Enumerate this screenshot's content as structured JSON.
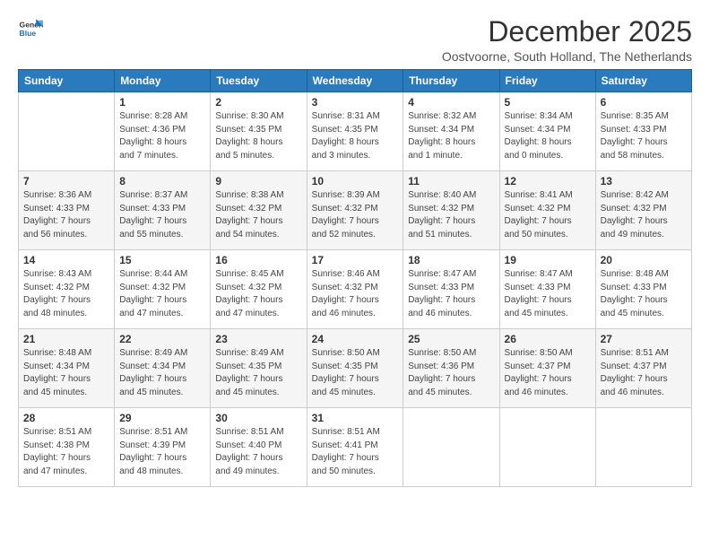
{
  "logo": {
    "text_general": "General",
    "text_blue": "Blue"
  },
  "header": {
    "title": "December 2025",
    "subtitle": "Oostvoorne, South Holland, The Netherlands"
  },
  "columns": [
    "Sunday",
    "Monday",
    "Tuesday",
    "Wednesday",
    "Thursday",
    "Friday",
    "Saturday"
  ],
  "weeks": [
    [
      {
        "day": "",
        "info": ""
      },
      {
        "day": "1",
        "info": "Sunrise: 8:28 AM\nSunset: 4:36 PM\nDaylight: 8 hours\nand 7 minutes."
      },
      {
        "day": "2",
        "info": "Sunrise: 8:30 AM\nSunset: 4:35 PM\nDaylight: 8 hours\nand 5 minutes."
      },
      {
        "day": "3",
        "info": "Sunrise: 8:31 AM\nSunset: 4:35 PM\nDaylight: 8 hours\nand 3 minutes."
      },
      {
        "day": "4",
        "info": "Sunrise: 8:32 AM\nSunset: 4:34 PM\nDaylight: 8 hours\nand 1 minute."
      },
      {
        "day": "5",
        "info": "Sunrise: 8:34 AM\nSunset: 4:34 PM\nDaylight: 8 hours\nand 0 minutes."
      },
      {
        "day": "6",
        "info": "Sunrise: 8:35 AM\nSunset: 4:33 PM\nDaylight: 7 hours\nand 58 minutes."
      }
    ],
    [
      {
        "day": "7",
        "info": "Sunrise: 8:36 AM\nSunset: 4:33 PM\nDaylight: 7 hours\nand 56 minutes."
      },
      {
        "day": "8",
        "info": "Sunrise: 8:37 AM\nSunset: 4:33 PM\nDaylight: 7 hours\nand 55 minutes."
      },
      {
        "day": "9",
        "info": "Sunrise: 8:38 AM\nSunset: 4:32 PM\nDaylight: 7 hours\nand 54 minutes."
      },
      {
        "day": "10",
        "info": "Sunrise: 8:39 AM\nSunset: 4:32 PM\nDaylight: 7 hours\nand 52 minutes."
      },
      {
        "day": "11",
        "info": "Sunrise: 8:40 AM\nSunset: 4:32 PM\nDaylight: 7 hours\nand 51 minutes."
      },
      {
        "day": "12",
        "info": "Sunrise: 8:41 AM\nSunset: 4:32 PM\nDaylight: 7 hours\nand 50 minutes."
      },
      {
        "day": "13",
        "info": "Sunrise: 8:42 AM\nSunset: 4:32 PM\nDaylight: 7 hours\nand 49 minutes."
      }
    ],
    [
      {
        "day": "14",
        "info": "Sunrise: 8:43 AM\nSunset: 4:32 PM\nDaylight: 7 hours\nand 48 minutes."
      },
      {
        "day": "15",
        "info": "Sunrise: 8:44 AM\nSunset: 4:32 PM\nDaylight: 7 hours\nand 47 minutes."
      },
      {
        "day": "16",
        "info": "Sunrise: 8:45 AM\nSunset: 4:32 PM\nDaylight: 7 hours\nand 47 minutes."
      },
      {
        "day": "17",
        "info": "Sunrise: 8:46 AM\nSunset: 4:32 PM\nDaylight: 7 hours\nand 46 minutes."
      },
      {
        "day": "18",
        "info": "Sunrise: 8:47 AM\nSunset: 4:33 PM\nDaylight: 7 hours\nand 46 minutes."
      },
      {
        "day": "19",
        "info": "Sunrise: 8:47 AM\nSunset: 4:33 PM\nDaylight: 7 hours\nand 45 minutes."
      },
      {
        "day": "20",
        "info": "Sunrise: 8:48 AM\nSunset: 4:33 PM\nDaylight: 7 hours\nand 45 minutes."
      }
    ],
    [
      {
        "day": "21",
        "info": "Sunrise: 8:48 AM\nSunset: 4:34 PM\nDaylight: 7 hours\nand 45 minutes."
      },
      {
        "day": "22",
        "info": "Sunrise: 8:49 AM\nSunset: 4:34 PM\nDaylight: 7 hours\nand 45 minutes."
      },
      {
        "day": "23",
        "info": "Sunrise: 8:49 AM\nSunset: 4:35 PM\nDaylight: 7 hours\nand 45 minutes."
      },
      {
        "day": "24",
        "info": "Sunrise: 8:50 AM\nSunset: 4:35 PM\nDaylight: 7 hours\nand 45 minutes."
      },
      {
        "day": "25",
        "info": "Sunrise: 8:50 AM\nSunset: 4:36 PM\nDaylight: 7 hours\nand 45 minutes."
      },
      {
        "day": "26",
        "info": "Sunrise: 8:50 AM\nSunset: 4:37 PM\nDaylight: 7 hours\nand 46 minutes."
      },
      {
        "day": "27",
        "info": "Sunrise: 8:51 AM\nSunset: 4:37 PM\nDaylight: 7 hours\nand 46 minutes."
      }
    ],
    [
      {
        "day": "28",
        "info": "Sunrise: 8:51 AM\nSunset: 4:38 PM\nDaylight: 7 hours\nand 47 minutes."
      },
      {
        "day": "29",
        "info": "Sunrise: 8:51 AM\nSunset: 4:39 PM\nDaylight: 7 hours\nand 48 minutes."
      },
      {
        "day": "30",
        "info": "Sunrise: 8:51 AM\nSunset: 4:40 PM\nDaylight: 7 hours\nand 49 minutes."
      },
      {
        "day": "31",
        "info": "Sunrise: 8:51 AM\nSunset: 4:41 PM\nDaylight: 7 hours\nand 50 minutes."
      },
      {
        "day": "",
        "info": ""
      },
      {
        "day": "",
        "info": ""
      },
      {
        "day": "",
        "info": ""
      }
    ]
  ]
}
